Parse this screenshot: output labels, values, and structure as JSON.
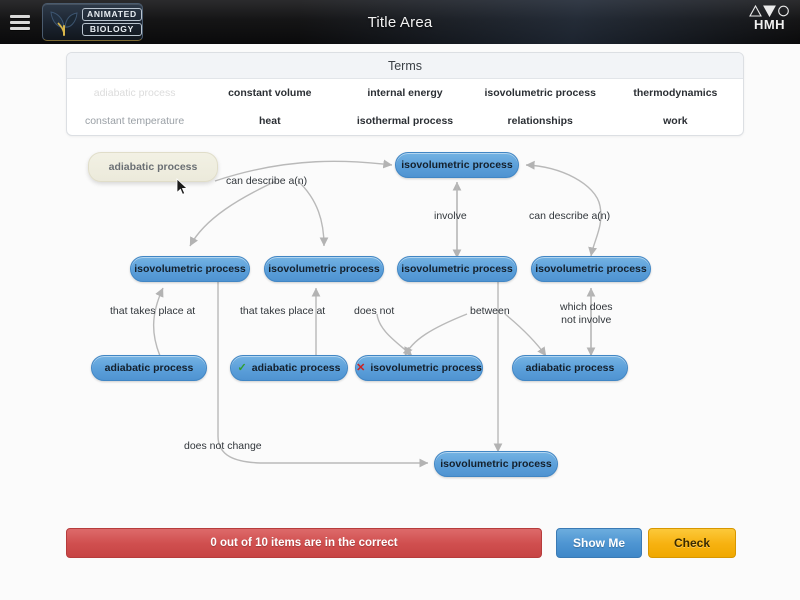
{
  "topbar": {
    "menu_icon": "hamburger-menu-icon",
    "brand_line1": "ANIMATED",
    "brand_line2": "BIOLOGY",
    "brand_icon": "leaf-logo-icon",
    "title": "Title Area",
    "publisher_logo_text": "HMH",
    "publisher_logo_icon": "hmh-triangles-circle-icon"
  },
  "terms": {
    "header": "Terms",
    "items": [
      {
        "label": "adiabatic process",
        "state": "used"
      },
      {
        "label": "constant volume",
        "state": "available"
      },
      {
        "label": "internal energy",
        "state": "available"
      },
      {
        "label": "isovolumetric process",
        "state": "available"
      },
      {
        "label": "thermodynamics",
        "state": "available"
      },
      {
        "label": "constant temperature",
        "state": "dim"
      },
      {
        "label": "heat",
        "state": "available"
      },
      {
        "label": "isothermal process",
        "state": "available"
      },
      {
        "label": "relationships",
        "state": "available"
      },
      {
        "label": "work",
        "state": "available"
      }
    ]
  },
  "diagram": {
    "dragging_node": {
      "label": "adiabatic process"
    },
    "nodes": [
      {
        "id": "n_top",
        "label": "isovolumetric process",
        "mark": ""
      },
      {
        "id": "n_r1c1",
        "label": "isovolumetric process",
        "mark": ""
      },
      {
        "id": "n_r1c2",
        "label": "isovolumetric process",
        "mark": ""
      },
      {
        "id": "n_r1c3",
        "label": "isovolumetric process",
        "mark": ""
      },
      {
        "id": "n_r1c4",
        "label": "isovolumetric process",
        "mark": ""
      },
      {
        "id": "n_r2c1",
        "label": "adiabatic process",
        "mark": ""
      },
      {
        "id": "n_r2c2",
        "label": "adiabatic process",
        "mark": "check"
      },
      {
        "id": "n_r2c3",
        "label": "isovolumetric process",
        "mark": "cross"
      },
      {
        "id": "n_r2c4",
        "label": "adiabatic process",
        "mark": ""
      },
      {
        "id": "n_bot",
        "label": "isovolumetric process",
        "mark": ""
      }
    ],
    "edge_labels": [
      {
        "id": "e1",
        "text": "can describe a(n)"
      },
      {
        "id": "e2",
        "text": "involve"
      },
      {
        "id": "e3",
        "text": "can describe a(n)"
      },
      {
        "id": "e4",
        "text": "that takes place at"
      },
      {
        "id": "e5",
        "text": "that takes place at"
      },
      {
        "id": "e6",
        "text": "does not"
      },
      {
        "id": "e7",
        "text": "between"
      },
      {
        "id": "e8",
        "text": "which does\nnot involve"
      },
      {
        "id": "e9",
        "text": "does not change"
      }
    ],
    "marks": {
      "check": "✓",
      "cross": "✕"
    }
  },
  "footer": {
    "status": "0 out of 10 items are in the correct",
    "show_me_label": "Show Me",
    "check_label": "Check"
  },
  "colors": {
    "node_blue": "#5ca0da",
    "drag_cream": "#eceadb",
    "status_red": "#d04f4f",
    "check_yellow": "#f7b211",
    "showme_blue": "#4e95d2",
    "mark_green": "#2f9e2f",
    "mark_red": "#cc2222"
  }
}
